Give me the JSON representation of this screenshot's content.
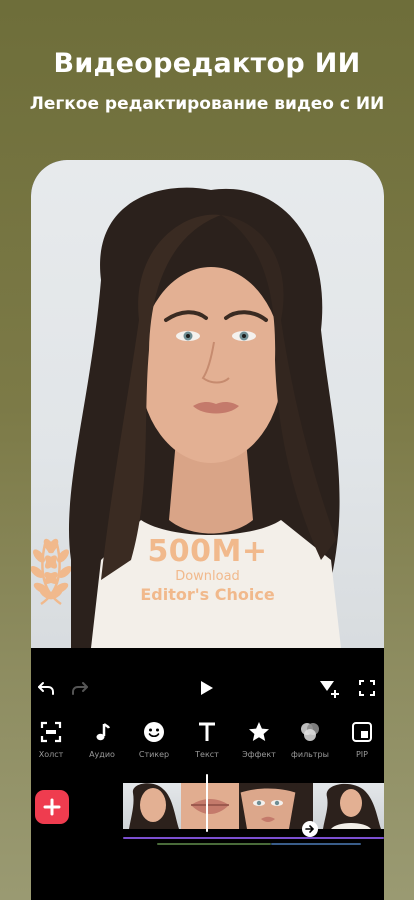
{
  "promo": {
    "headline": "Видеоредактор ИИ",
    "subheadline": "Легкое редактирование видео с ИИ"
  },
  "badge": {
    "number": "500M+",
    "subtitle": "Download",
    "title": "Editor's Choice",
    "color": "#f1b98c"
  },
  "toolbar": {
    "undo_icon": "undo-icon",
    "redo_icon": "redo-icon",
    "play_icon": "play-icon",
    "keyframe_icon": "keyframe-add-icon",
    "fullscreen_icon": "fullscreen-icon"
  },
  "tools": [
    {
      "label": "Холст",
      "icon": "canvas-icon"
    },
    {
      "label": "Аудио",
      "icon": "music-note-icon"
    },
    {
      "label": "Стикер",
      "icon": "smiley-icon"
    },
    {
      "label": "Текст",
      "icon": "text-icon"
    },
    {
      "label": "Эффект",
      "icon": "star-icon"
    },
    {
      "label": "фильтры",
      "icon": "filters-icon"
    },
    {
      "label": "PIP",
      "icon": "pip-icon"
    }
  ],
  "timeline": {
    "add_icon": "plus-icon",
    "transition_icon": "arrow-right-icon"
  },
  "colors": {
    "accent": "#ef3c4f",
    "background_top": "#6e6e3a",
    "background_bottom": "#9a9a72"
  }
}
